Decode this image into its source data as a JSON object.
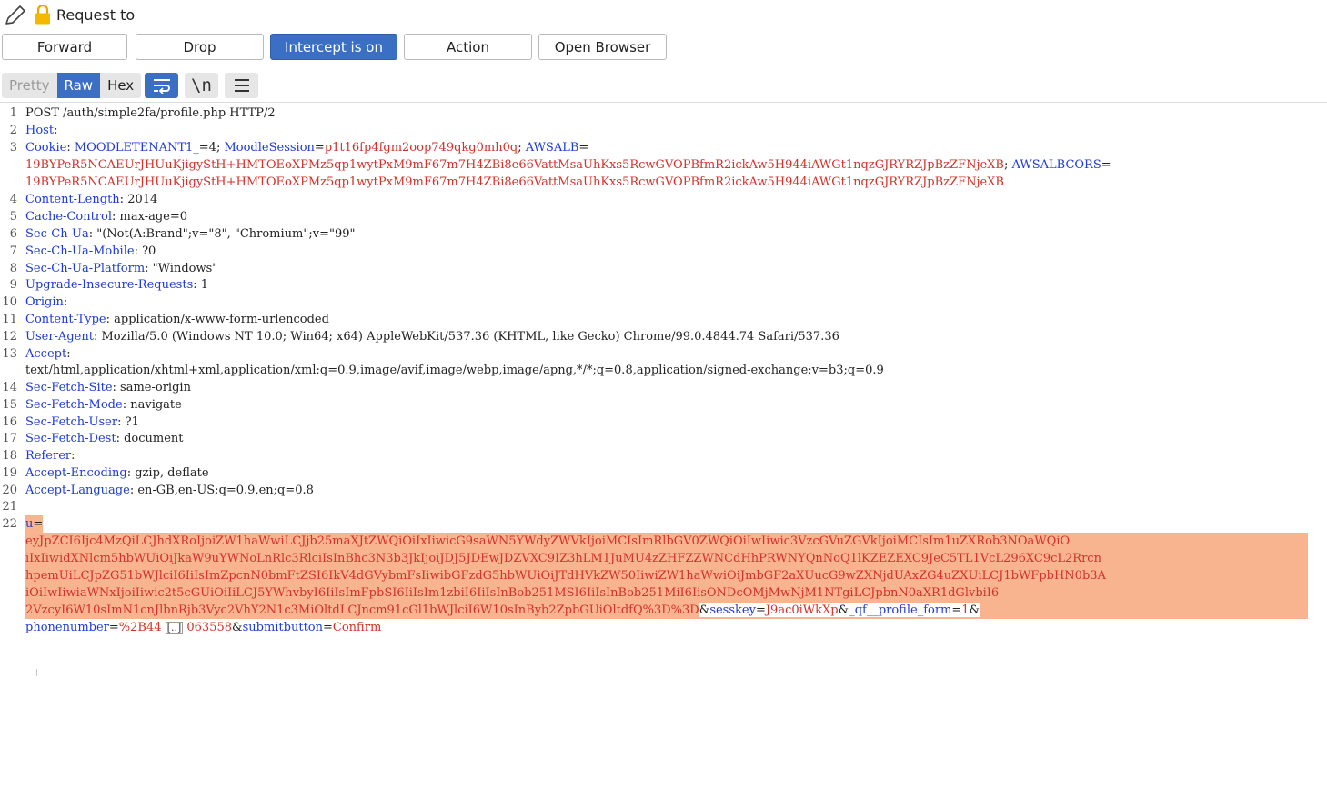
{
  "header": {
    "title": "Request to"
  },
  "actions": [
    {
      "label": "Forward",
      "primary": false
    },
    {
      "label": "Drop",
      "primary": false
    },
    {
      "label": "Intercept is on",
      "primary": true
    },
    {
      "label": "Action",
      "primary": false
    },
    {
      "label": "Open Browser",
      "primary": false
    }
  ],
  "view_tabs": [
    {
      "label": "Pretty",
      "active": false
    },
    {
      "label": "Raw",
      "active": true
    },
    {
      "label": "Hex",
      "active": false
    }
  ],
  "view_icons": {
    "wrap": "wrap-lines-icon",
    "newline": "\\n",
    "menu": "hamburger-menu-icon"
  },
  "colors": {
    "accent": "#3a6fc4",
    "header_key": "#1e3ad8",
    "value_red": "#d3312a",
    "highlight": "#f8b48f"
  },
  "request": {
    "request_line": "POST /auth/simple2fa/profile.php HTTP/2",
    "headers": [
      {
        "n": "2",
        "key": "Host",
        "value": ""
      },
      {
        "n": "4",
        "key": "Content-Length",
        "value": " 2014"
      },
      {
        "n": "5",
        "key": "Cache-Control",
        "value": " max-age=0"
      },
      {
        "n": "6",
        "key": "Sec-Ch-Ua",
        "value": " \"(Not(A:Brand\";v=\"8\", \"Chromium\";v=\"99\""
      },
      {
        "n": "7",
        "key": "Sec-Ch-Ua-Mobile",
        "value": " ?0"
      },
      {
        "n": "8",
        "key": "Sec-Ch-Ua-Platform",
        "value": " \"Windows\""
      },
      {
        "n": "9",
        "key": "Upgrade-Insecure-Requests",
        "value": " 1"
      },
      {
        "n": "10",
        "key": "Origin",
        "value": ""
      },
      {
        "n": "11",
        "key": "Content-Type",
        "value": " application/x-www-form-urlencoded"
      },
      {
        "n": "12",
        "key": "User-Agent",
        "value": " Mozilla/5.0 (Windows NT 10.0; Win64; x64) AppleWebKit/537.36 (KHTML, like Gecko) Chrome/99.0.4844.74 Safari/537.36"
      },
      {
        "n": "13",
        "key": "Accept",
        "value": ""
      },
      {
        "n": "14",
        "key": "Sec-Fetch-Site",
        "value": " same-origin"
      },
      {
        "n": "15",
        "key": "Sec-Fetch-Mode",
        "value": " navigate"
      },
      {
        "n": "16",
        "key": "Sec-Fetch-User",
        "value": " ?1"
      },
      {
        "n": "17",
        "key": "Sec-Fetch-Dest",
        "value": " document"
      },
      {
        "n": "18",
        "key": "Referer",
        "value": ""
      },
      {
        "n": "19",
        "key": "Accept-Encoding",
        "value": " gzip, deflate"
      },
      {
        "n": "20",
        "key": "Accept-Language",
        "value": " en-GB,en-US;q=0.9,en;q=0.8"
      }
    ],
    "accept_value": "text/html,application/xhtml+xml,application/xml;q=0.9,image/avif,image/webp,image/apng,*/*;q=0.8,application/signed-exchange;v=b3;q=0.9",
    "cookie": {
      "key": "Cookie",
      "c1_name": "MOODLETENANT1_",
      "c1_value": "=4; ",
      "c2_name": "MoodleSession",
      "c2_value": "p1t16fp4fgm2oop749qkg0mh0q",
      "c3_name": "AWSALB",
      "c3_value": "19BYPeR5NCAEUrJHUuKjigyStH+HMTOEoXPMz5qp1wytPxM9mF67m7H4ZBi8e66VattMsaUhKxs5RcwGVOPBfmR2ickAw5H944iAWGt1nqzGJRYRZJpBzZFNjeXB",
      "c4_name": "AWSALBCORS",
      "c4_value": "19BYPeR5NCAEUrJHUuKjigyStH+HMTOEoXPMz5qp1wytPxM9mF67m7H4ZBi8e66VattMsaUhKxs5RcwGVOPBfmR2ickAw5H944iAWGt1nqzGJRYRZJpBzZFNjeXB"
    },
    "body": {
      "u_key": "u",
      "u_lines": [
        "eyJpZCI6Ijc4MzQiLCJhdXRoIjoiZW1haWwiLCJjb25maXJtZWQiOiIxIiwicG9saWN5YWdyZWVkIjoiMCIsImRlbGV0ZWQiOiIwIiwic3VzcGVuZGVkIjoiMCIsIm1uZXRob3NOaWQiO",
        "iIxIiwidXNlcm5hbWUiOiJkaW9uYWNoLnRlc3RlciIsInBhc3N3b3JkIjoiJDJ5JDEwJDZVXC9IZ3hLM1JuMU4zZHFZZWNCdHhPRWNYQnNoQ1lKZEZEXC9JeC5TL1VcL296XC9cL2Rrcn",
        "hpemUiLCJpZG51bWJlciI6IiIsImZpcnN0bmFtZSI6IkV4dGVybmFsIiwibGFzdG5hbWUiOiJTdHVkZW50IiwiZW1haWwiOiJmbGF2aXUucG9wZXNjdUAxZG4uZXUiLCJ1bWFpbHN0b3A",
        "iOiIwIiwiaWNxIjoiIiwic2t5cGUiOiIiLCJ5YWhvbyI6IiIsImFpbSI6IiIsIm1zbiI6IiIsInBob251MSI6IiIsInBob251MiI6IisONDcOMjMwNjM1NTgiLCJpbnN0aXR1dGlvbiI6",
        "2VzcyI6W10sImN1cnJlbnRjb3Vyc2VhY2N1c3MiOltdLCJncm91cGl1bWJlciI6W10sInByb2ZpbGUiOltdfQ%3D%3D"
      ],
      "sesskey_key": "sesskey",
      "sesskey_val": "J9ac0iWkXp",
      "qf_key": "_qf__profile_form",
      "qf_val": "1",
      "phone_key": "phonenumber",
      "phone_val": "%2B44",
      "phone_ellipsis": "[..]",
      "phone_tail": " 063558",
      "submit_key": "submitbutton",
      "submit_val": "Confirm"
    }
  }
}
